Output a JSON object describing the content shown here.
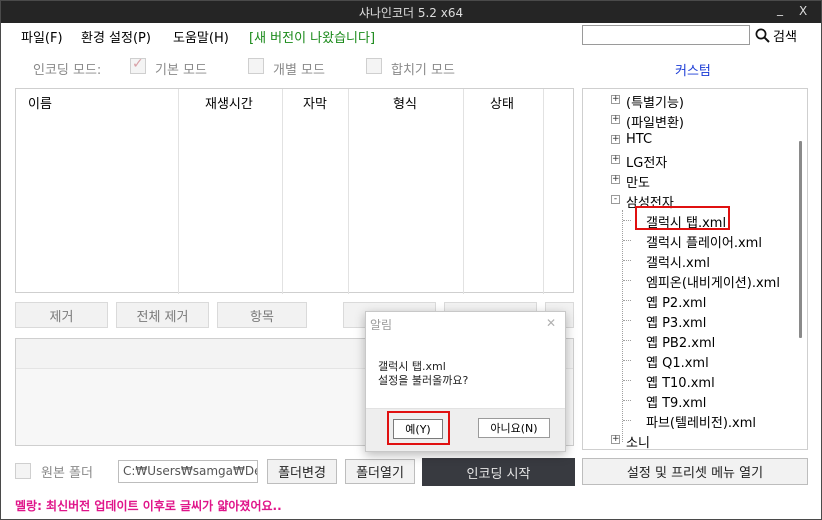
{
  "window": {
    "title": "샤나인코더  5.2  x64",
    "minimize_glyph": "_",
    "close_glyph": "X"
  },
  "menubar": {
    "items": [
      "파일(F)",
      "환경 설정(P)",
      "도움말(H)"
    ],
    "new_version": "[새 버전이 나왔습니다]",
    "search_placeholder": "",
    "search_label": "검색",
    "search_icon": "magnifier-icon"
  },
  "modes": {
    "label": "인코딩 모드:",
    "items": [
      {
        "label": "기본 모드",
        "checked": true
      },
      {
        "label": "개별 모드",
        "checked": false
      },
      {
        "label": "합치기 모드",
        "checked": false
      }
    ],
    "custom_label": "커스텀"
  },
  "file_list": {
    "columns": [
      "이름",
      "재생시간",
      "자막",
      "형식",
      "상태"
    ]
  },
  "list_buttons": [
    "제거",
    "전체 제거",
    "항목",
    "",
    "",
    ""
  ],
  "tree": {
    "items": [
      {
        "label": "(특별기능)",
        "expander": "+"
      },
      {
        "label": "(파일변환)",
        "expander": "+"
      },
      {
        "label": "HTC",
        "expander": "+"
      },
      {
        "label": "LG전자",
        "expander": "+"
      },
      {
        "label": "만도",
        "expander": "+"
      },
      {
        "label": "삼성전자",
        "expander": "-"
      },
      {
        "label": "갤럭시 탭.xml",
        "child": true,
        "selected": true
      },
      {
        "label": "갤럭시 플레이어.xml",
        "child": true
      },
      {
        "label": "갤럭시.xml",
        "child": true
      },
      {
        "label": "엠피온(내비게이션).xml",
        "child": true
      },
      {
        "label": "옙 P2.xml",
        "child": true
      },
      {
        "label": "옙 P3.xml",
        "child": true
      },
      {
        "label": "옙 PB2.xml",
        "child": true
      },
      {
        "label": "옙 Q1.xml",
        "child": true
      },
      {
        "label": "옙 T10.xml",
        "child": true
      },
      {
        "label": "옙 T9.xml",
        "child": true
      },
      {
        "label": "파브(텔레비전).xml",
        "child": true
      },
      {
        "label": "소니",
        "expander": "+"
      }
    ]
  },
  "bottom": {
    "source_folder_label": "원본 폴더",
    "path_value": "C:₩Users₩samga₩De",
    "change_folder": "폴더변경",
    "open_folder": "폴더열기",
    "start_encoding": "인코딩 시작",
    "settings_menu": "설정 및 프리셋 메뉴 열기"
  },
  "status": {
    "text": "멜랑: 최신버전 업데이트 이후로 글씨가 얇아졌어요.."
  },
  "dialog": {
    "title": "알림",
    "close_glyph": "✕",
    "message_line1": "갤럭시 탭.xml",
    "message_line2": "설정을 불러올까요?",
    "yes_label": "예(Y)",
    "no_label": "아니요(N)"
  },
  "colors": {
    "titlebar": "#252525",
    "new_version": "#1a8a1a",
    "custom_link": "#1a3bd6",
    "status_text": "#e0158a",
    "highlight": "#e01010",
    "start_button": "#383a40"
  }
}
